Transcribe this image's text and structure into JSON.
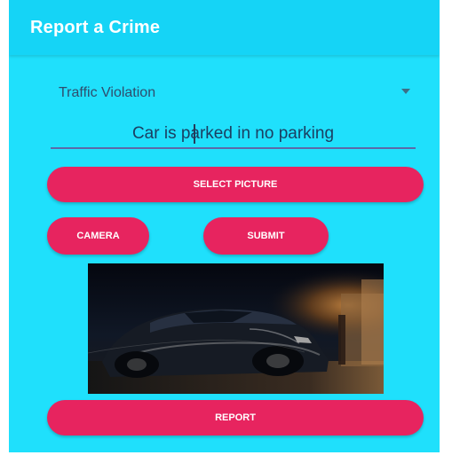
{
  "app_bar": {
    "title": "Report a Crime"
  },
  "form": {
    "crime_type": {
      "selected": "Traffic Violation"
    },
    "description": {
      "value": "Car is parked in no parking"
    }
  },
  "buttons": {
    "select_picture": "SELECT PICTURE",
    "camera": "CAMERA",
    "submit": "SUBMIT",
    "report": "REPORT"
  },
  "image_preview": {
    "content": "photo of a dark car parked at night"
  },
  "colors": {
    "background": "#1fe0fc",
    "app_bar": "#15d4f6",
    "button": "#e7245f",
    "button_text": "#ffffff",
    "field_underline": "#5b6aa8"
  },
  "icons": {
    "spinner_arrow": "dropdown-arrow-icon"
  }
}
